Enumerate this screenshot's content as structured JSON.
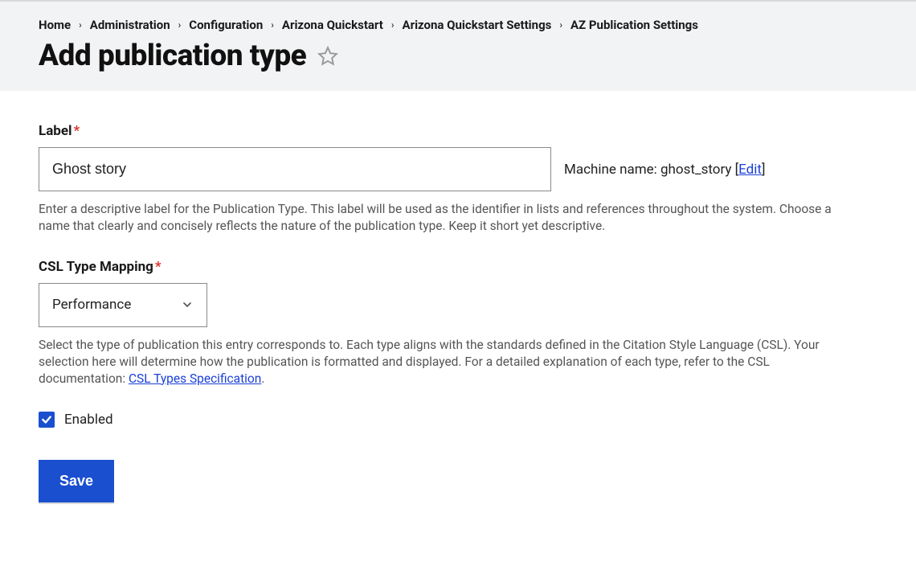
{
  "breadcrumb": {
    "items": [
      "Home",
      "Administration",
      "Configuration",
      "Arizona Quickstart",
      "Arizona Quickstart Settings",
      "AZ Publication Settings"
    ]
  },
  "page_title": "Add publication type",
  "form": {
    "label": {
      "title": "Label",
      "value": "Ghost story",
      "machine_name_prefix": "Machine name: ",
      "machine_name": "ghost_story",
      "edit_text": "Edit",
      "description": "Enter a descriptive label for the Publication Type. This label will be used as the identifier in lists and references throughout the system. Choose a name that clearly and concisely reflects the nature of the publication type. Keep it short yet descriptive."
    },
    "csl": {
      "title": "CSL Type Mapping",
      "value": "Performance",
      "description_pre": "Select the type of publication this entry corresponds to. Each type aligns with the standards defined in the Citation Style Language (CSL). Your selection here will determine how the publication is formatted and displayed. For a detailed explanation of each type, refer to the CSL documentation: ",
      "link_text": "CSL Types Specification",
      "description_post": "."
    },
    "enabled_label": "Enabled",
    "save_label": "Save"
  }
}
